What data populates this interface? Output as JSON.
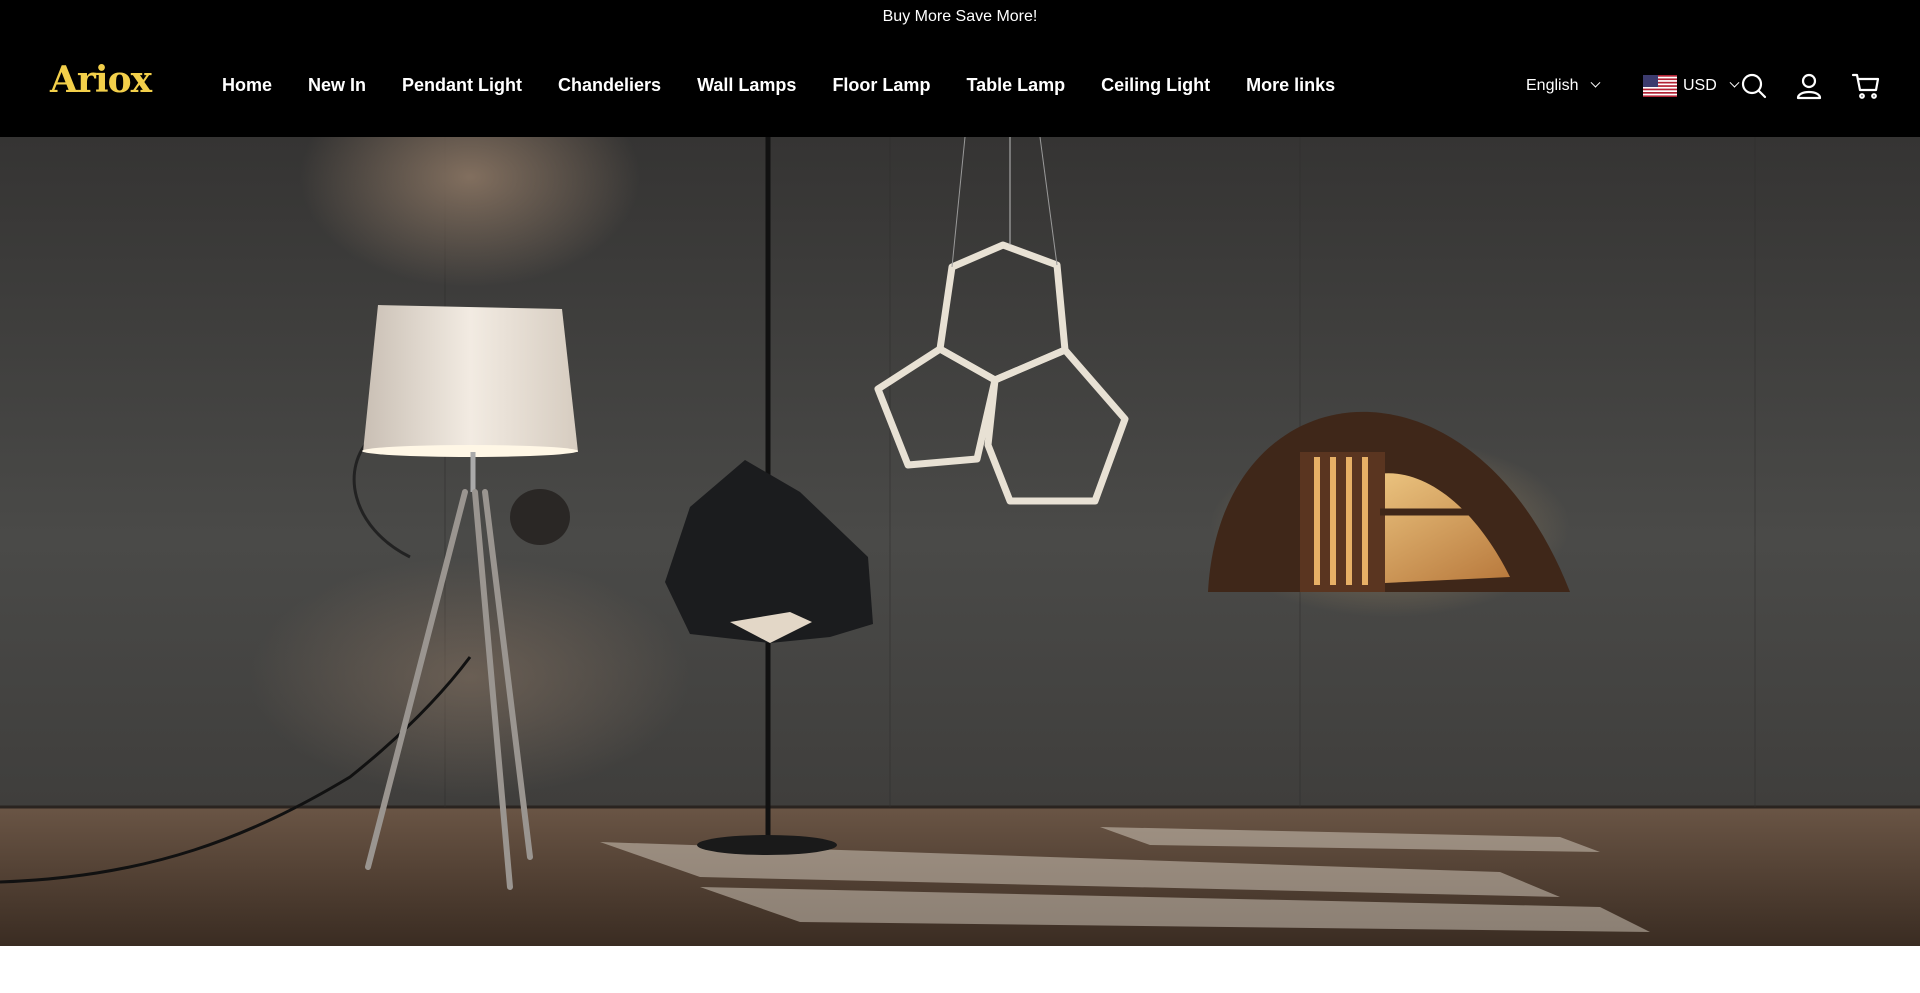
{
  "announcement": {
    "text": "Buy More Save More!"
  },
  "brand": {
    "logo_text": "Ariox",
    "logo_color": "#f2cf4a"
  },
  "nav": {
    "items": [
      {
        "label": "Home"
      },
      {
        "label": "New In"
      },
      {
        "label": "Pendant Light"
      },
      {
        "label": "Chandeliers"
      },
      {
        "label": "Wall Lamps"
      },
      {
        "label": "Floor Lamp"
      },
      {
        "label": "Table Lamp"
      },
      {
        "label": "Ceiling Light"
      },
      {
        "label": "More links"
      }
    ]
  },
  "header_utils": {
    "language": "English",
    "currency": "USD",
    "icons": [
      "search-icon",
      "account-icon",
      "cart-icon",
      "us-flag-icon",
      "chevron-down-icon"
    ]
  },
  "colors": {
    "header_bg": "#000000",
    "header_text": "#ffffff",
    "accent": "#f2cf4a"
  }
}
